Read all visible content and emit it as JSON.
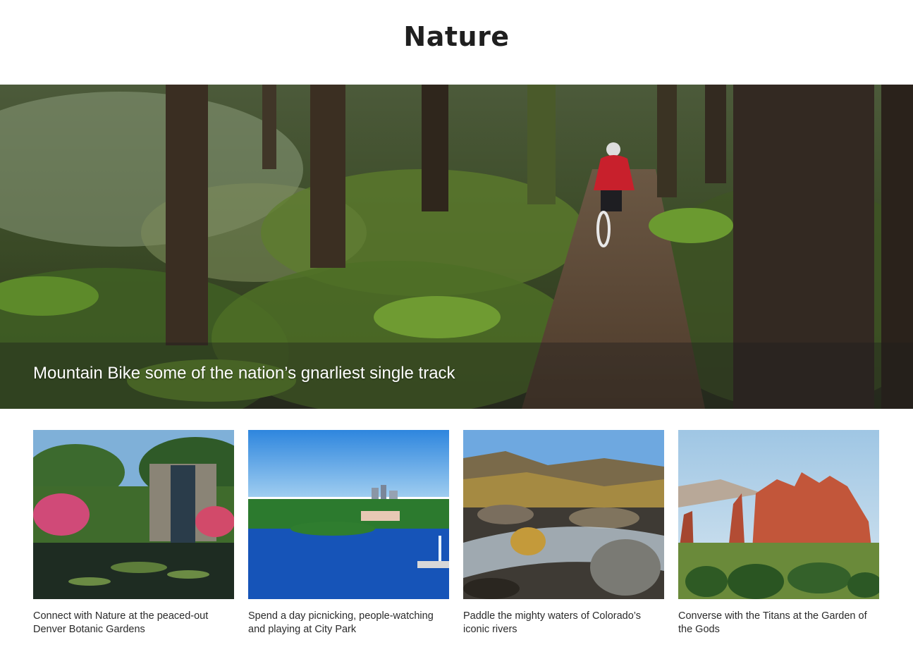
{
  "page": {
    "title": "Nature"
  },
  "hero": {
    "caption": "Mountain Bike some of the nation’s gnarliest single track",
    "image": "mountain-biker-forest-trail"
  },
  "cards": [
    {
      "caption": "Connect with Nature at the peaced-out Denver Botanic Gardens",
      "image": "botanic-gardens-fountain"
    },
    {
      "caption": "Spend a day picnicking, people-watching and playing at City Park",
      "image": "city-park-lake-skyline"
    },
    {
      "caption": "Paddle the mighty waters of Colorado’s iconic rivers",
      "image": "rocky-river-rapids"
    },
    {
      "caption": "Converse with the Titans at the Garden of the Gods",
      "image": "garden-of-the-gods-red-rocks"
    }
  ],
  "colors": {
    "forest_dark": "#2f3a22",
    "fern_green": "#5f8a2e",
    "sky_blue": "#3f8fd8",
    "red_rock": "#c2563a"
  }
}
